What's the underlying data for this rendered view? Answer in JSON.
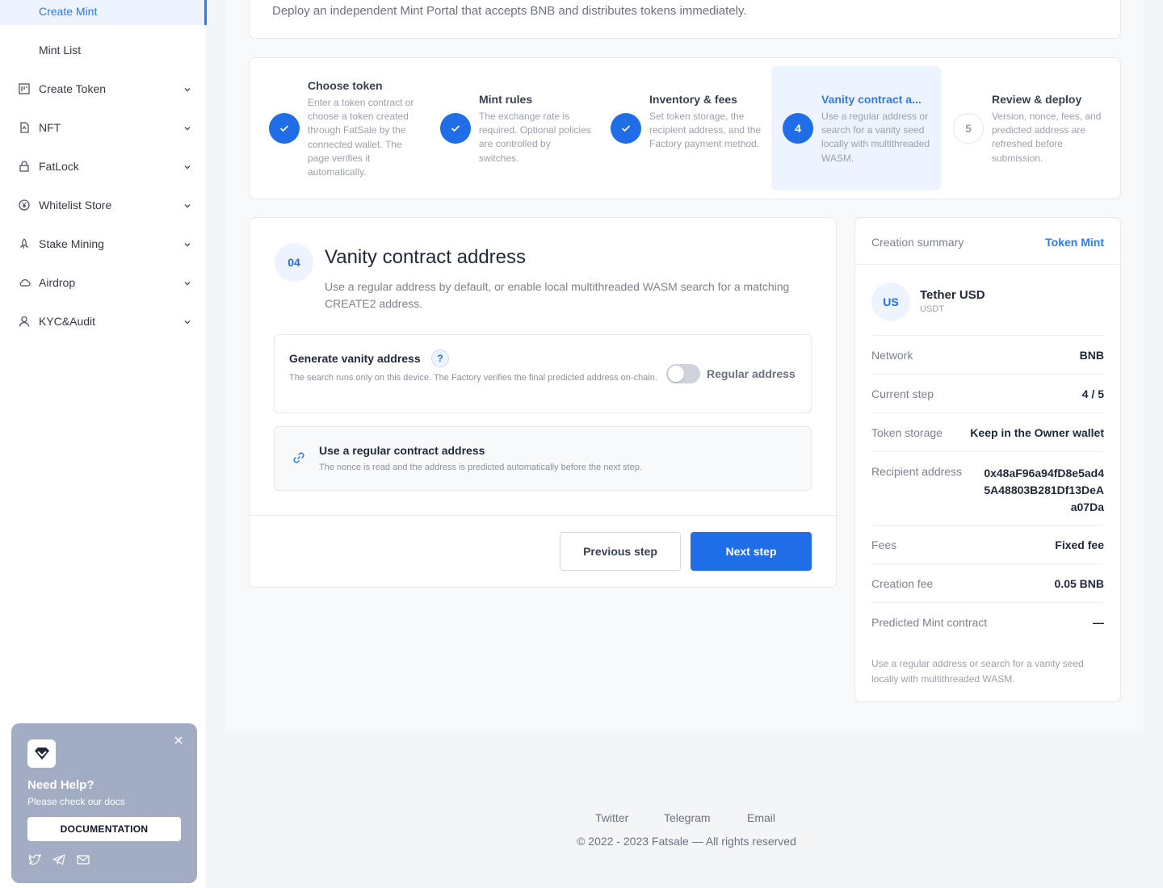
{
  "sidebar": {
    "items": [
      {
        "label": "Create Mint",
        "icon": "none",
        "active": true,
        "sub": true
      },
      {
        "label": "Mint List",
        "icon": "none",
        "active": false,
        "sub": true
      },
      {
        "label": "Create Token",
        "icon": "token-icon"
      },
      {
        "label": "NFT",
        "icon": "nft-icon"
      },
      {
        "label": "FatLock",
        "icon": "lock-icon"
      },
      {
        "label": "Whitelist Store",
        "icon": "yen-icon"
      },
      {
        "label": "Stake Mining",
        "icon": "rocket-icon"
      },
      {
        "label": "Airdrop",
        "icon": "cloud-icon"
      },
      {
        "label": "KYC&Audit",
        "icon": "user-icon"
      }
    ],
    "help": {
      "title": "Need Help?",
      "subtitle": "Please check our docs",
      "button": "DOCUMENTATION"
    }
  },
  "header": {
    "description": "Deploy an independent Mint Portal that accepts BNB and distributes tokens immediately."
  },
  "steps": [
    {
      "num": "1",
      "state": "done",
      "title": "Choose token",
      "desc": "Enter a token contract or choose a token created through FatSale by the connected wallet. The page verifies it automatically."
    },
    {
      "num": "2",
      "state": "done",
      "title": "Mint rules",
      "desc": "The exchange rate is required. Optional policies are controlled by switches."
    },
    {
      "num": "3",
      "state": "done",
      "title": "Inventory & fees",
      "desc": "Set token storage, the recipient address, and the Factory payment method."
    },
    {
      "num": "4",
      "state": "current",
      "title": "Vanity contract a...",
      "desc": "Use a regular address or search for a vanity seed locally with multithreaded WASM."
    },
    {
      "num": "5",
      "state": "todo",
      "title": "Review & deploy",
      "desc": "Version, nonce, fees, and predicted address are refreshed before submission."
    }
  ],
  "form": {
    "badge": "04",
    "title": "Vanity contract address",
    "description": "Use a regular address by default, or enable local multithreaded WASM search for a matching CREATE2 address.",
    "vanity": {
      "title": "Generate vanity address",
      "help": "?",
      "desc": "The search runs only on this device. The Factory verifies the final predicted address on-chain.",
      "toggle_label": "Regular address",
      "toggle_on": false
    },
    "regular": {
      "title": "Use a regular contract address",
      "desc": "The nonce is read and the address is predicted automatically before the next step."
    },
    "prev_label": "Previous step",
    "next_label": "Next step"
  },
  "summary": {
    "title": "Creation summary",
    "type": "Token Mint",
    "token": {
      "avatar": "US",
      "name": "Tether USD",
      "symbol": "USDT"
    },
    "rows": [
      {
        "key": "Network",
        "value": "BNB"
      },
      {
        "key": "Current step",
        "value": "4 / 5"
      },
      {
        "key": "Token storage",
        "value": "Keep in the Owner wallet"
      },
      {
        "key": "Recipient address",
        "value": "0x48aF96a94fD8e5ad45A48803B281Df13DeAa07Da"
      },
      {
        "key": "Fees",
        "value": "Fixed fee"
      },
      {
        "key": "Creation fee",
        "value": "0.05 BNB"
      },
      {
        "key": "Predicted Mint contract",
        "value": "—"
      }
    ],
    "note": "Use a regular address or search for a vanity seed locally with multithreaded WASM."
  },
  "footer": {
    "links": [
      "Twitter",
      "Telegram",
      "Email"
    ],
    "copyright": "© 2022 - 2023 Fatsale — All rights reserved"
  },
  "colors": {
    "accent": "#1f6ee8",
    "accent_light": "#edf4ff",
    "help_bg": "#a2acc3"
  }
}
